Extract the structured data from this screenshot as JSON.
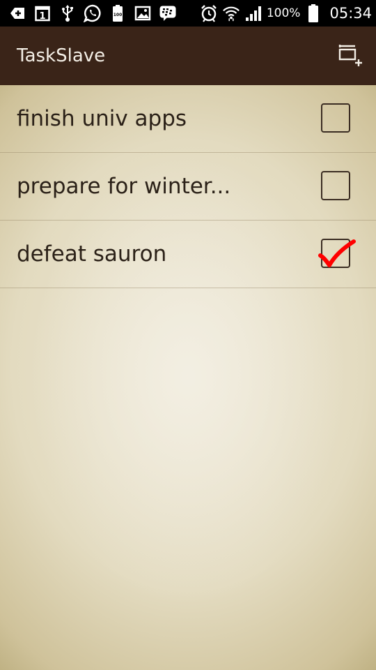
{
  "status_bar": {
    "battery_percent": "100%",
    "time": "05:34",
    "icons_left": [
      "add-icon",
      "calendar-icon",
      "usb-icon",
      "whatsapp-icon",
      "battery-100-icon",
      "gallery-icon",
      "bbm-icon"
    ],
    "icons_right": [
      "alarm-icon",
      "wifi-icon",
      "signal-icon",
      "battery-icon"
    ]
  },
  "app": {
    "title": "TaskSlave",
    "add_list_icon": "add-list-icon"
  },
  "tasks": [
    {
      "label": "finish univ apps",
      "checked": false
    },
    {
      "label": "prepare for winter...",
      "checked": false
    },
    {
      "label": "defeat sauron",
      "checked": true
    }
  ],
  "colors": {
    "action_bar": "#3a2418",
    "check_mark": "#ff0000",
    "text": "#2b2118"
  },
  "calendar_icon_text": "1",
  "battery_icon_text": "100"
}
